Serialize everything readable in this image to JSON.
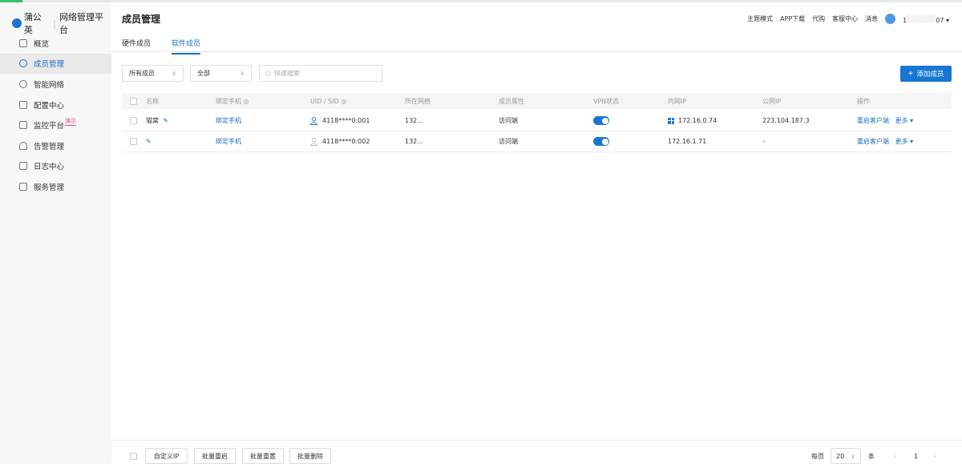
{
  "app": {
    "brand": "蒲公英",
    "platform": "网络管理平台"
  },
  "sidebar": {
    "items": [
      {
        "label": "概览",
        "icon": "home-icon"
      },
      {
        "label": "成员管理",
        "icon": "layers-icon",
        "active": true
      },
      {
        "label": "智能网络",
        "icon": "network-icon"
      },
      {
        "label": "配置中心",
        "icon": "grid-icon"
      },
      {
        "label": "监控平台",
        "icon": "monitor-icon",
        "badge": "演示"
      },
      {
        "label": "告警管理",
        "icon": "bell-icon"
      },
      {
        "label": "日志中心",
        "icon": "clipboard-icon"
      },
      {
        "label": "服务管理",
        "icon": "document-icon"
      }
    ]
  },
  "header": {
    "title": "成员管理",
    "links": [
      "主题模式",
      "APP下载",
      "代购",
      "客服中心",
      "消息"
    ],
    "user": {
      "prefix": "1",
      "suffix": "07"
    }
  },
  "tabs": [
    {
      "label": "硬件成员"
    },
    {
      "label": "软件成员",
      "active": true
    }
  ],
  "toolbar": {
    "filter1": "所有成员",
    "filter2": "全部",
    "search_placeholder": "快速搜索",
    "add_label": "添加成员"
  },
  "table": {
    "columns": [
      "名称",
      "绑定手机",
      "UID / SID",
      "所在网络",
      "成员属性",
      "VPN状态",
      "内网IP",
      "公网IP",
      "操作"
    ],
    "rows": [
      {
        "name": "猫窝",
        "phone": "绑定手机",
        "uid": "4118****0:001",
        "network": "132...",
        "attr": "访问端",
        "vpn": true,
        "lan_ip": "172.16.0.74",
        "os": "windows",
        "public_ip": "223.104.187.3",
        "action": "重启客户端",
        "more": "更多"
      },
      {
        "name": "",
        "phone": "绑定手机",
        "uid": "4118****0:002",
        "network": "132...",
        "attr": "访问端",
        "vpn": true,
        "lan_ip": "172.16.1.71",
        "os": "",
        "public_ip": "-",
        "action": "重启客户端",
        "more": "更多"
      }
    ]
  },
  "bottom": {
    "buttons": [
      "自定义IP",
      "批量重启",
      "批量重置",
      "批量删除"
    ],
    "per_page_label": "每页",
    "per_page": "20",
    "unit": "条",
    "page": "1"
  },
  "colors": {
    "accent": "#1677d2",
    "badge": "#e0457b"
  }
}
